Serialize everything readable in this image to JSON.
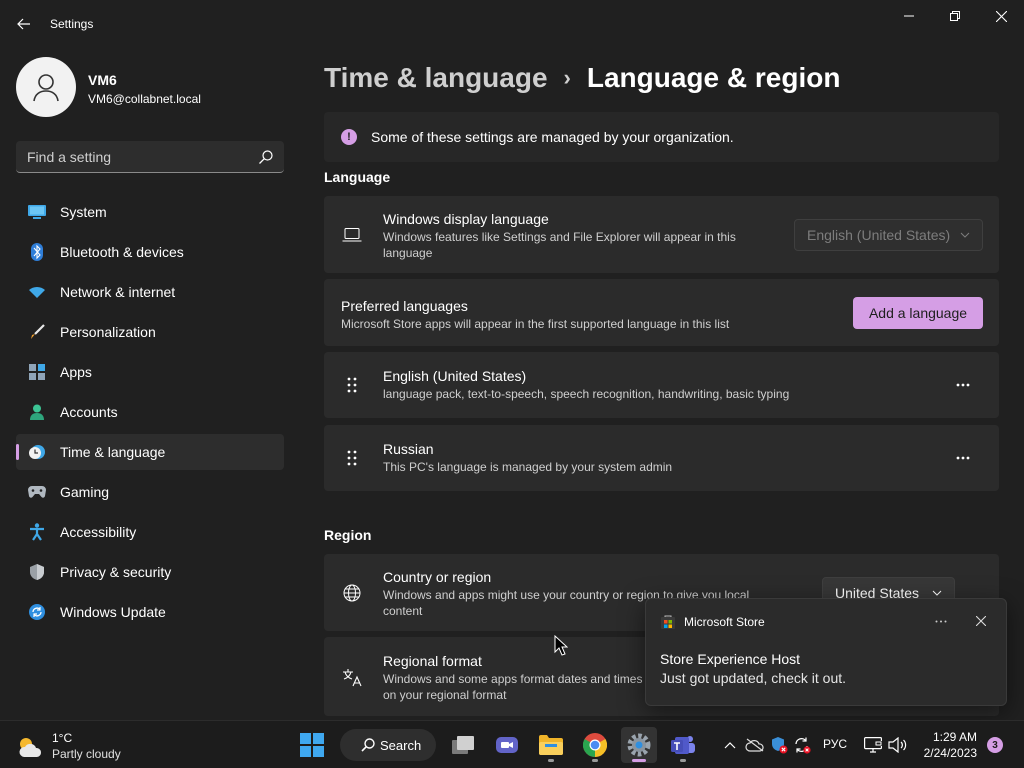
{
  "window": {
    "title": "Settings"
  },
  "profile": {
    "name": "VM6",
    "email": "VM6@collabnet.local"
  },
  "search": {
    "placeholder": "Find a setting"
  },
  "sidebar": {
    "items": [
      {
        "label": "System",
        "icon": "monitor-icon"
      },
      {
        "label": "Bluetooth & devices",
        "icon": "bluetooth-icon"
      },
      {
        "label": "Network & internet",
        "icon": "wifi-icon"
      },
      {
        "label": "Personalization",
        "icon": "brush-icon"
      },
      {
        "label": "Apps",
        "icon": "apps-icon"
      },
      {
        "label": "Accounts",
        "icon": "person-icon"
      },
      {
        "label": "Time & language",
        "icon": "clock-globe-icon",
        "active": true
      },
      {
        "label": "Gaming",
        "icon": "gamepad-icon"
      },
      {
        "label": "Accessibility",
        "icon": "accessibility-icon"
      },
      {
        "label": "Privacy & security",
        "icon": "shield-icon"
      },
      {
        "label": "Windows Update",
        "icon": "update-icon"
      }
    ]
  },
  "breadcrumb": {
    "parent": "Time & language",
    "separator": "›",
    "current": "Language & region"
  },
  "info_bar": {
    "text": "Some of these settings are managed by your organization."
  },
  "language_section": {
    "heading": "Language",
    "display_language": {
      "title": "Windows display language",
      "subtitle": "Windows features like Settings and File Explorer will appear in this language",
      "value": "English (United States)"
    },
    "preferred": {
      "title": "Preferred languages",
      "subtitle": "Microsoft Store apps will appear in the first supported language in this list",
      "button": "Add a language"
    },
    "languages": [
      {
        "name": "English (United States)",
        "detail": "language pack, text-to-speech, speech recognition, handwriting, basic typing"
      },
      {
        "name": "Russian",
        "detail": "This PC's language is managed by your system admin"
      }
    ]
  },
  "region_section": {
    "heading": "Region",
    "country": {
      "title": "Country or region",
      "subtitle": "Windows and apps might use your country or region to give you local content",
      "value": "United States"
    },
    "format": {
      "title": "Regional format",
      "subtitle": "Windows and some apps format dates and times based on your regional format"
    }
  },
  "toast": {
    "app": "Microsoft Store",
    "title": "Store Experience Host",
    "message": "Just got updated, check it out."
  },
  "taskbar": {
    "weather_temp": "1°C",
    "weather_desc": "Partly cloudy",
    "search_label": "Search",
    "lang": "РУС",
    "time": "1:29 AM",
    "date": "2/24/2023",
    "notifications": "3"
  },
  "colors": {
    "accent": "#d59ee5",
    "background": "#202020",
    "card": "#2b2b2b"
  }
}
